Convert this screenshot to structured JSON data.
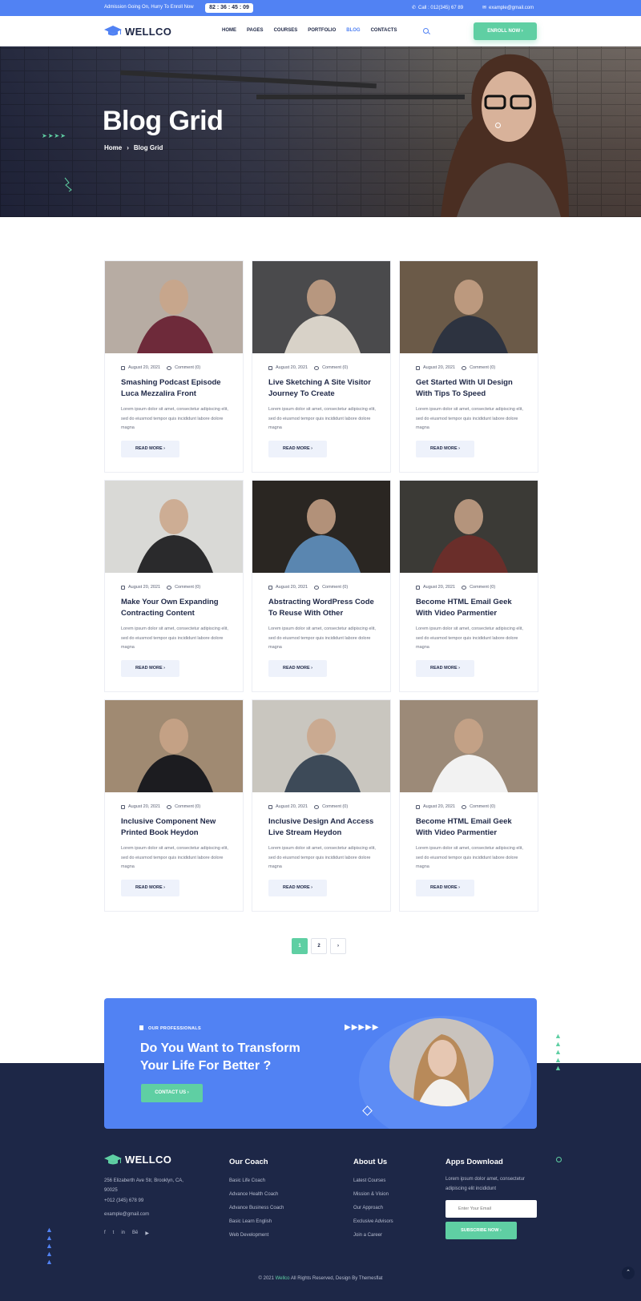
{
  "topbar": {
    "promo": "Admission Going On, Hurry To Enroll Now",
    "timer": "82 : 36 : 45 : 09",
    "phone": "Call : 012(345) 67 89",
    "email": "example@gmail.com"
  },
  "header": {
    "logo": "WELLCO",
    "nav": [
      "HOME",
      "PAGES",
      "COURSES",
      "PORTFOLIO",
      "BLOG",
      "CONTACTS"
    ],
    "active_nav": "BLOG",
    "enroll": "ENROLL NOW"
  },
  "hero": {
    "title": "Blog Grid",
    "breadcrumb": [
      "Home",
      "Blog Grid"
    ],
    "arrows": "➤➤➤➤"
  },
  "posts": [
    {
      "date": "August 20, 2021",
      "comments": "Comment (0)",
      "title": "Smashing Podcast Episode Luca Mezzalira Front",
      "excerpt": "Lorem ipsum dolor sit amet, consectetur adipiscing elit, sed do eiusmod tempor quis incididunt labore dolore magna",
      "cta": "READ MORE",
      "img": {
        "bg": "#b7aca3",
        "fg": "#6e2a3a"
      }
    },
    {
      "date": "August 20, 2021",
      "comments": "Comment (0)",
      "title": "Live Sketching A Site Visitor Journey To Create",
      "excerpt": "Lorem ipsum dolor sit amet, consectetur adipiscing elit, sed do eiusmod tempor quis incididunt labore dolore magna",
      "cta": "READ MORE",
      "img": {
        "bg": "#4a4a4c",
        "fg": "#d8d2c8"
      }
    },
    {
      "date": "August 20, 2021",
      "comments": "Comment (0)",
      "title": "Get Started With UI Design With Tips To Speed",
      "excerpt": "Lorem ipsum dolor sit amet, consectetur adipiscing elit, sed do eiusmod tempor quis incididunt labore dolore magna",
      "cta": "READ MORE",
      "img": {
        "bg": "#6b5a48",
        "fg": "#2d3340"
      }
    },
    {
      "date": "August 20, 2021",
      "comments": "Comment (0)",
      "title": "Make Your Own Expanding Contracting Content",
      "excerpt": "Lorem ipsum dolor sit amet, consectetur adipiscing elit, sed do eiusmod tempor quis incididunt labore dolore magna",
      "cta": "READ MORE",
      "img": {
        "bg": "#d9d9d6",
        "fg": "#2a2a2c"
      }
    },
    {
      "date": "August 20, 2021",
      "comments": "Comment (0)",
      "title": "Abstracting WordPress Code To Reuse With Other",
      "excerpt": "Lorem ipsum dolor sit amet, consectetur adipiscing elit, sed do eiusmod tempor quis incididunt labore dolore magna",
      "cta": "READ MORE",
      "img": {
        "bg": "#2a2622",
        "fg": "#5a86b0"
      }
    },
    {
      "date": "August 20, 2021",
      "comments": "Comment (0)",
      "title": "Become HTML Email Geek With Video Parmentier",
      "excerpt": "Lorem ipsum dolor sit amet, consectetur adipiscing elit, sed do eiusmod tempor quis incididunt labore dolore magna",
      "cta": "READ MORE",
      "img": {
        "bg": "#3b3a36",
        "fg": "#6a2e2a"
      }
    },
    {
      "date": "August 20, 2021",
      "comments": "Comment (0)",
      "title": "Inclusive Component New Printed Book Heydon",
      "excerpt": "Lorem ipsum dolor sit amet, consectetur adipiscing elit, sed do eiusmod tempor quis incididunt labore dolore magna",
      "cta": "READ MORE",
      "img": {
        "bg": "#a08a72",
        "fg": "#1c1c20"
      }
    },
    {
      "date": "August 20, 2021",
      "comments": "Comment (0)",
      "title": "Inclusive Design And Access Live Stream Heydon",
      "excerpt": "Lorem ipsum dolor sit amet, consectetur adipiscing elit, sed do eiusmod tempor quis incididunt labore dolore magna",
      "cta": "READ MORE",
      "img": {
        "bg": "#c9c6bf",
        "fg": "#3d4a58"
      }
    },
    {
      "date": "August 20, 2021",
      "comments": "Comment (0)",
      "title": "Become HTML Email Geek With Video Parmentier",
      "excerpt": "Lorem ipsum dolor sit amet, consectetur adipiscing elit, sed do eiusmod tempor quis incididunt labore dolore magna",
      "cta": "READ MORE",
      "img": {
        "bg": "#9c8a78",
        "fg": "#f2f2f2"
      }
    }
  ],
  "pagination": {
    "pages": [
      "1",
      "2"
    ],
    "next": "›",
    "current": "1"
  },
  "cta": {
    "label": "OUR PROFESSIONALS",
    "title": "Do You Want to Transform Your Life For Better ?",
    "button": "CONTACT US",
    "play_icons": "▶▶▶▶▶"
  },
  "footer": {
    "logo": "WELLCO",
    "address": "256 Elizaberth Ave Str, Brooklyn, CA, 90025",
    "phone": "+012 (345) 678 99",
    "email": "example@gmail.com",
    "social": [
      "f",
      "t",
      "in",
      "Bē",
      "▶"
    ],
    "coach": {
      "heading": "Our Coach",
      "links": [
        "Basic Life Coach",
        "Advance Health Coach",
        "Advance Business Coach",
        "Basic Learn English",
        "Web Development"
      ]
    },
    "about": {
      "heading": "About Us",
      "links": [
        "Latest Courses",
        "Mission & Vision",
        "Our Approach",
        "Exclusive Advisors",
        "Join a Career"
      ]
    },
    "apps": {
      "heading": "Apps Download",
      "text": "Lorem ipsum dolor amet, consectetur adipiscing elit incididunt",
      "placeholder": "Enter Your Email",
      "button": "SUBSCRIBE NOW"
    },
    "copyright_pre": "© 2021",
    "copyright_brand": "Wellco",
    "copyright_post": "All Rights Reserved, Design By Themesflat"
  },
  "colors": {
    "accent": "#5182f3",
    "green": "#5fcfa3",
    "navy": "#1d2747"
  }
}
